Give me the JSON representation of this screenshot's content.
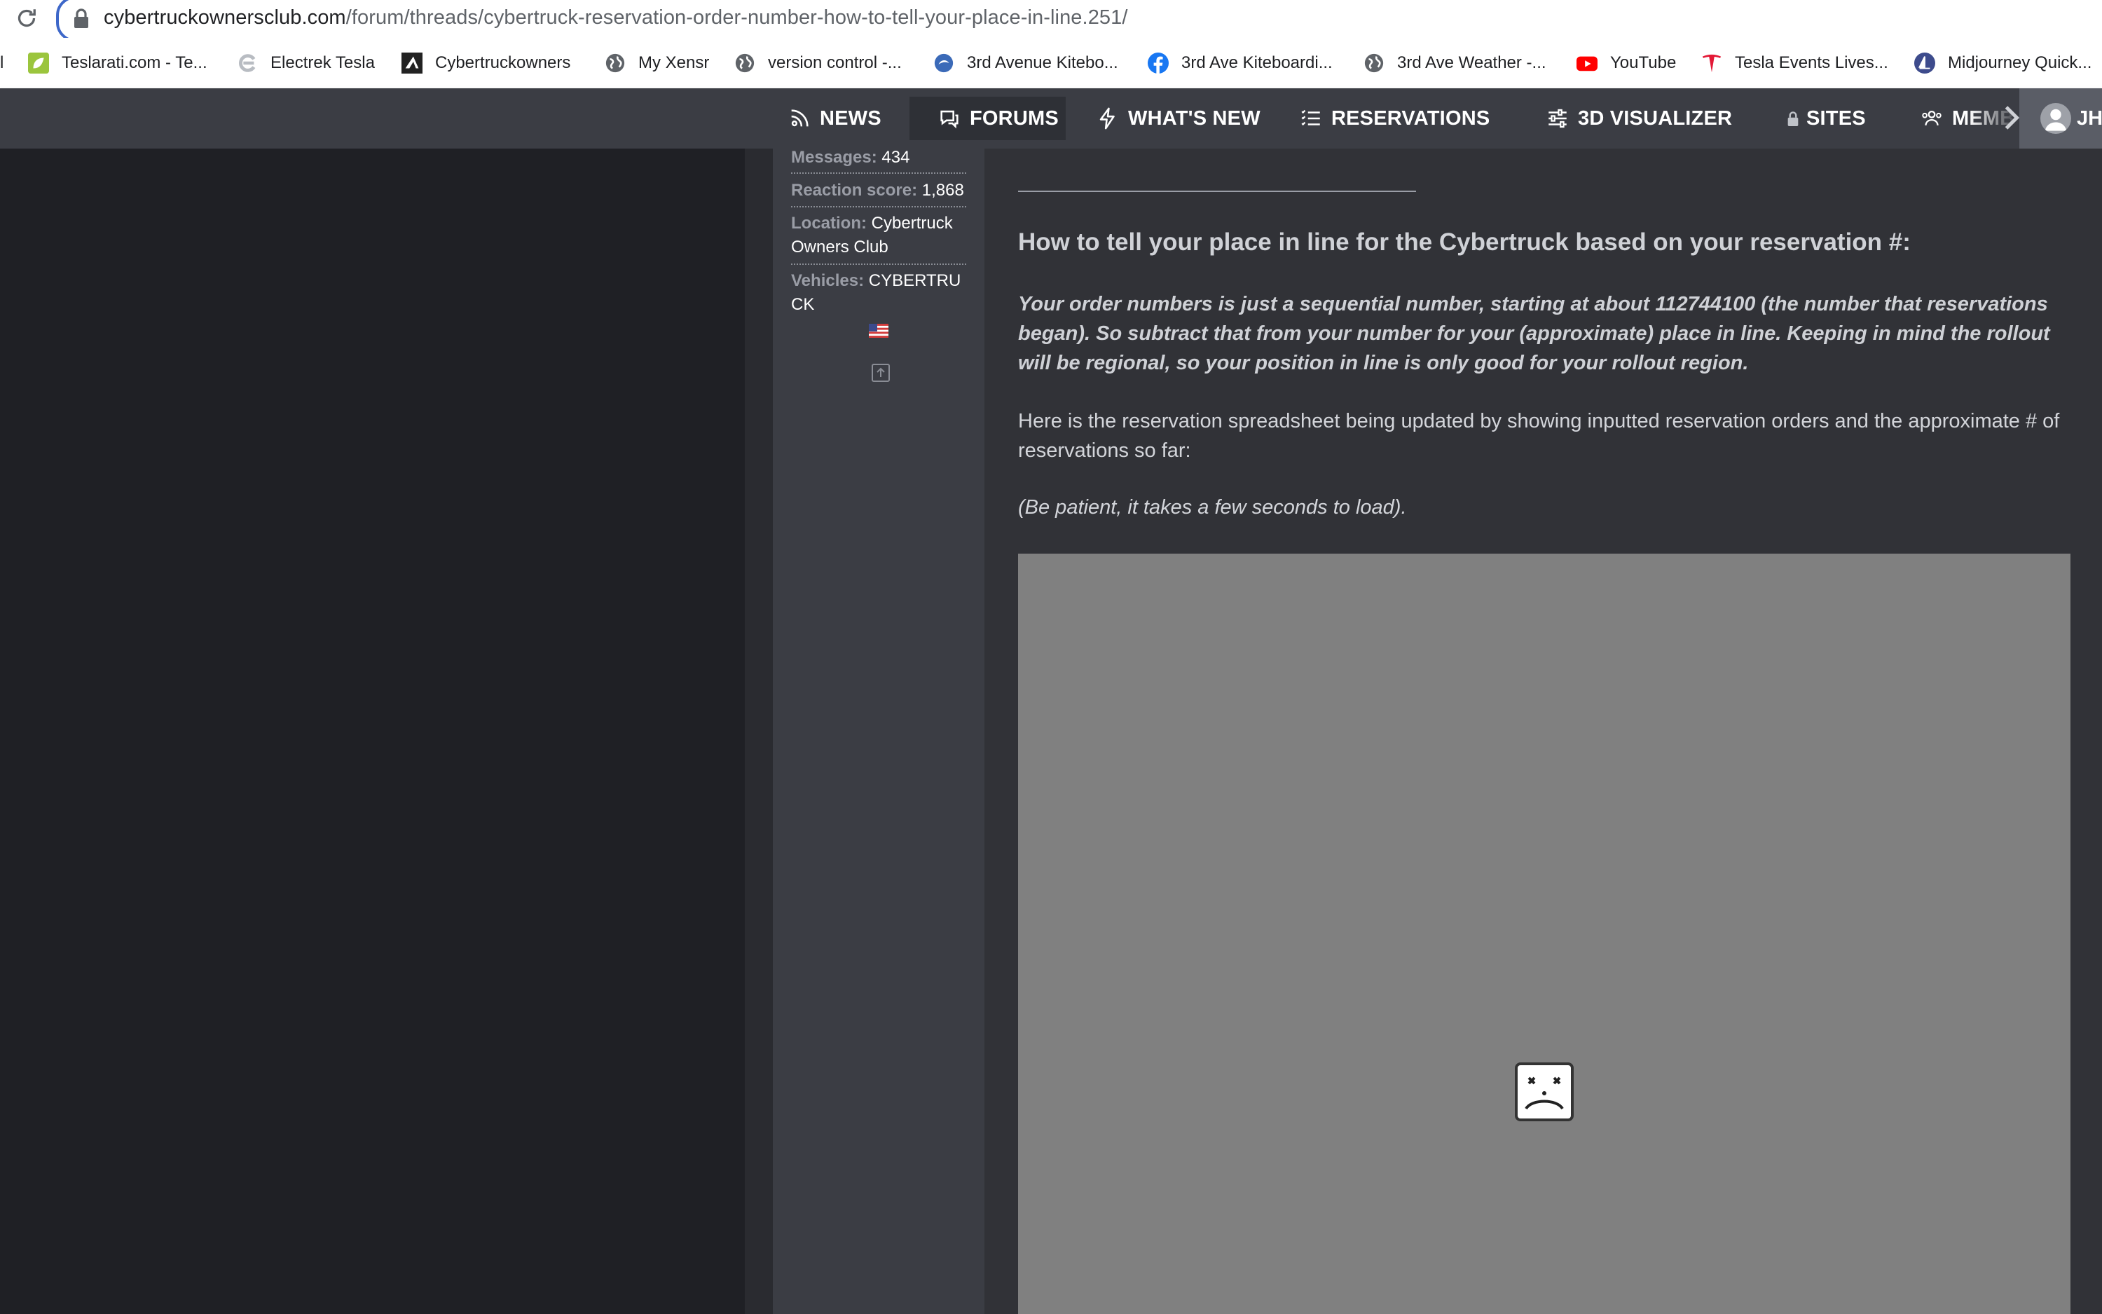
{
  "browser": {
    "url_domain": "cybertruckownersclub.com",
    "url_path": "/forum/threads/cybertruck-reservation-order-number-how-to-tell-your-place-in-line.251/",
    "bookmarks": [
      {
        "label": "l",
        "icon": "partial-edge"
      },
      {
        "label": "Teslarati.com - Te...",
        "icon": "leaf-icon"
      },
      {
        "label": "Electrek Tesla",
        "icon": "electrek-e-icon"
      },
      {
        "label": "Cybertruckowners",
        "icon": "cybertruck-icon"
      },
      {
        "label": "My Xensr",
        "icon": "globe-icon"
      },
      {
        "label": "version control -...",
        "icon": "globe-icon"
      },
      {
        "label": "3rd Avenue Kitebo...",
        "icon": "site-icon"
      },
      {
        "label": "3rd Ave Kiteboardi...",
        "icon": "facebook-icon"
      },
      {
        "label": "3rd Ave Weather -...",
        "icon": "globe-icon"
      },
      {
        "label": "YouTube",
        "icon": "youtube-icon"
      },
      {
        "label": "Tesla Events Lives...",
        "icon": "tesla-icon"
      },
      {
        "label": "Midjourney Quick...",
        "icon": "midjourney-icon"
      }
    ]
  },
  "nav": {
    "items": [
      {
        "label": "NEWS",
        "icon": "news-icon"
      },
      {
        "label": "FORUMS",
        "icon": "chat-icon",
        "active": true
      },
      {
        "label": "WHAT'S NEW",
        "icon": "bolt-icon"
      },
      {
        "label": "RESERVATIONS",
        "icon": "list-icon"
      },
      {
        "label": "3D VISUALIZER",
        "icon": "sliders-icon"
      },
      {
        "label": "SITES",
        "icon": "lock-icon"
      },
      {
        "label": "MEMB",
        "icon": "members-icon"
      }
    ],
    "user_initials": "JH"
  },
  "user_stats": {
    "messages_label": "Messages:",
    "messages_value": "434",
    "reaction_label": "Reaction score:",
    "reaction_value": "1,868",
    "location_label": "Location:",
    "location_value": "Cybertruck Owners Club",
    "vehicles_label": "Vehicles:",
    "vehicles_value": "CYBERTRUCK"
  },
  "post": {
    "heading": "How to tell your place in line for the Cybertruck based on your reservation #:",
    "bold_paragraph": "Your order numbers is just a sequential number, starting at about 112744100 (the number that reservations began). So subtract that from your number for your (approximate) place in line. Keeping in mind the rollout will be regional, so your position in line is only good for your rollout region.",
    "paragraph": "Here is the reservation spreadsheet being updated by showing inputted reservation orders and the approximate # of reservations so far:",
    "note": "(Be patient, it takes a few seconds to load)."
  }
}
